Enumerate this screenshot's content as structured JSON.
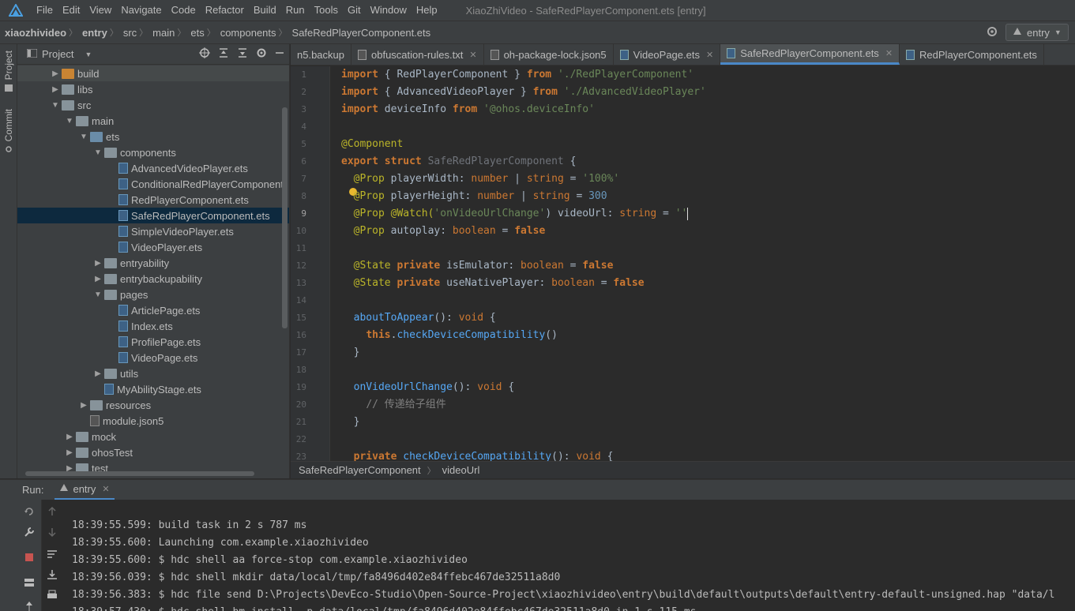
{
  "menubar": {
    "items": [
      "File",
      "Edit",
      "View",
      "Navigate",
      "Code",
      "Refactor",
      "Build",
      "Run",
      "Tools",
      "Git",
      "Window",
      "Help"
    ],
    "window_title": "XiaoZhiVideo - SafeRedPlayerComponent.ets [entry]"
  },
  "navbar": {
    "crumbs": [
      "xiaozhivideo",
      "entry",
      "src",
      "main",
      "ets",
      "components",
      "SafeRedPlayerComponent.ets"
    ],
    "run_config": "entry"
  },
  "left_strip": {
    "project": "Project",
    "commit": "Commit"
  },
  "project_panel": {
    "title": "Project",
    "tree": [
      {
        "label": "build",
        "type": "folder-orange",
        "arrow": "▶"
      },
      {
        "label": "libs",
        "type": "folder",
        "arrow": "▶"
      },
      {
        "label": "src",
        "type": "folder",
        "arrow": "▼"
      },
      {
        "label": "main",
        "type": "folder",
        "arrow": "▼"
      },
      {
        "label": "ets",
        "type": "folder-blue",
        "arrow": "▼"
      },
      {
        "label": "components",
        "type": "folder",
        "arrow": "▼"
      },
      {
        "label": "AdvancedVideoPlayer.ets",
        "type": "ets",
        "arrow": ""
      },
      {
        "label": "ConditionalRedPlayerComponent",
        "type": "ets",
        "arrow": ""
      },
      {
        "label": "RedPlayerComponent.ets",
        "type": "ets",
        "arrow": ""
      },
      {
        "label": "SafeRedPlayerComponent.ets",
        "type": "ets",
        "arrow": ""
      },
      {
        "label": "SimpleVideoPlayer.ets",
        "type": "ets",
        "arrow": ""
      },
      {
        "label": "VideoPlayer.ets",
        "type": "ets",
        "arrow": ""
      },
      {
        "label": "entryability",
        "type": "folder",
        "arrow": "▶"
      },
      {
        "label": "entrybackupability",
        "type": "folder",
        "arrow": "▶"
      },
      {
        "label": "pages",
        "type": "folder",
        "arrow": "▼"
      },
      {
        "label": "ArticlePage.ets",
        "type": "ets",
        "arrow": ""
      },
      {
        "label": "Index.ets",
        "type": "ets",
        "arrow": ""
      },
      {
        "label": "ProfilePage.ets",
        "type": "ets",
        "arrow": ""
      },
      {
        "label": "VideoPage.ets",
        "type": "ets",
        "arrow": ""
      },
      {
        "label": "utils",
        "type": "folder",
        "arrow": "▶"
      },
      {
        "label": "MyAbilityStage.ets",
        "type": "ets",
        "arrow": ""
      },
      {
        "label": "resources",
        "type": "folder",
        "arrow": "▶"
      },
      {
        "label": "module.json5",
        "type": "json",
        "arrow": ""
      },
      {
        "label": "mock",
        "type": "folder",
        "arrow": "▶"
      },
      {
        "label": "ohosTest",
        "type": "folder",
        "arrow": "▶"
      },
      {
        "label": "test",
        "type": "folder",
        "arrow": "▶"
      }
    ]
  },
  "editor_tabs": [
    {
      "label": "n5.backup",
      "icon": "txt",
      "close": false
    },
    {
      "label": "obfuscation-rules.txt",
      "icon": "txt",
      "close": true
    },
    {
      "label": "oh-package-lock.json5",
      "icon": "txt",
      "close": false
    },
    {
      "label": "VideoPage.ets",
      "icon": "ets",
      "close": true
    },
    {
      "label": "SafeRedPlayerComponent.ets",
      "icon": "ets",
      "close": true
    },
    {
      "label": "RedPlayerComponent.ets",
      "icon": "ets",
      "close": false
    }
  ],
  "code_lines": [
    "1",
    "2",
    "3",
    "4",
    "5",
    "6",
    "7",
    "8",
    "9",
    "10",
    "11",
    "12",
    "13",
    "14",
    "15",
    "16",
    "17",
    "18",
    "19",
    "20",
    "21",
    "22",
    "23"
  ],
  "code": {
    "l1": [
      "import",
      " { RedPlayerComponent } ",
      "from",
      " './RedPlayerComponent'"
    ],
    "l2": [
      "import",
      " { AdvancedVideoPlayer } ",
      "from",
      " './AdvancedVideoPlayer'"
    ],
    "l3": [
      "import",
      " deviceInfo ",
      "from",
      " '@ohos.deviceInfo'"
    ],
    "l5": "@Component",
    "l6": [
      "export struct",
      " SafeRedPlayerComponent",
      " {"
    ],
    "l7": [
      "@Prop",
      " playerWidth",
      ": ",
      "number",
      " | ",
      "string",
      " = ",
      "'100%'"
    ],
    "l8": [
      "@Prop",
      " playerHeight",
      ": ",
      "number",
      " | ",
      "string",
      " = ",
      "300"
    ],
    "l9": [
      "@Prop",
      " @Watch(",
      "'onVideoUrlChange'",
      ") videoUrl",
      ": ",
      "string",
      " = ",
      "''"
    ],
    "l10": [
      "@Prop",
      " autoplay",
      ": ",
      "boolean",
      " = ",
      "false"
    ],
    "l12": [
      "@State",
      " private",
      " isEmulator",
      ": ",
      "boolean",
      " = ",
      "false"
    ],
    "l13": [
      "@State",
      " private",
      " useNativePlayer",
      ": ",
      "boolean",
      " = ",
      "false"
    ],
    "l15": [
      "aboutToAppear",
      "(): ",
      "void",
      " {"
    ],
    "l16": [
      "this",
      ".",
      "checkDeviceCompatibility",
      "()"
    ],
    "l17": "}",
    "l19": [
      "onVideoUrlChange",
      "(): ",
      "void",
      " {"
    ],
    "l20": "// 传递给子组件",
    "l21": "}",
    "l23": [
      "private",
      " checkDeviceCompatibility",
      "(): ",
      "void",
      " {"
    ]
  },
  "editor_breadcrumb": [
    "SafeRedPlayerComponent",
    "videoUrl"
  ],
  "run_panel": {
    "label": "Run:",
    "tab": "entry",
    "console": [
      "18:39:55.599: build task in 2 s 787 ms",
      "18:39:55.600: Launching com.example.xiaozhivideo",
      "18:39:55.600: $ hdc shell aa force-stop com.example.xiaozhivideo",
      "18:39:56.039: $ hdc shell mkdir data/local/tmp/fa8496d402e84ffebc467de32511a8d0",
      "18:39:56.383: $ hdc file send D:\\Projects\\DevEco-Studio\\Open-Source-Project\\xiaozhivideo\\entry\\build\\default\\outputs\\default\\entry-default-unsigned.hap \"data/l",
      "18:39:57.430: $ hdc shell bm install -p data/local/tmp/fa8496d402e84ffebc467de32511a8d0 in 1 s 115 ms"
    ]
  },
  "colors": {
    "accent": "#4a88c7",
    "selection": "#0d293e",
    "background": "#2b2b2b",
    "panel": "#3c3f41"
  }
}
